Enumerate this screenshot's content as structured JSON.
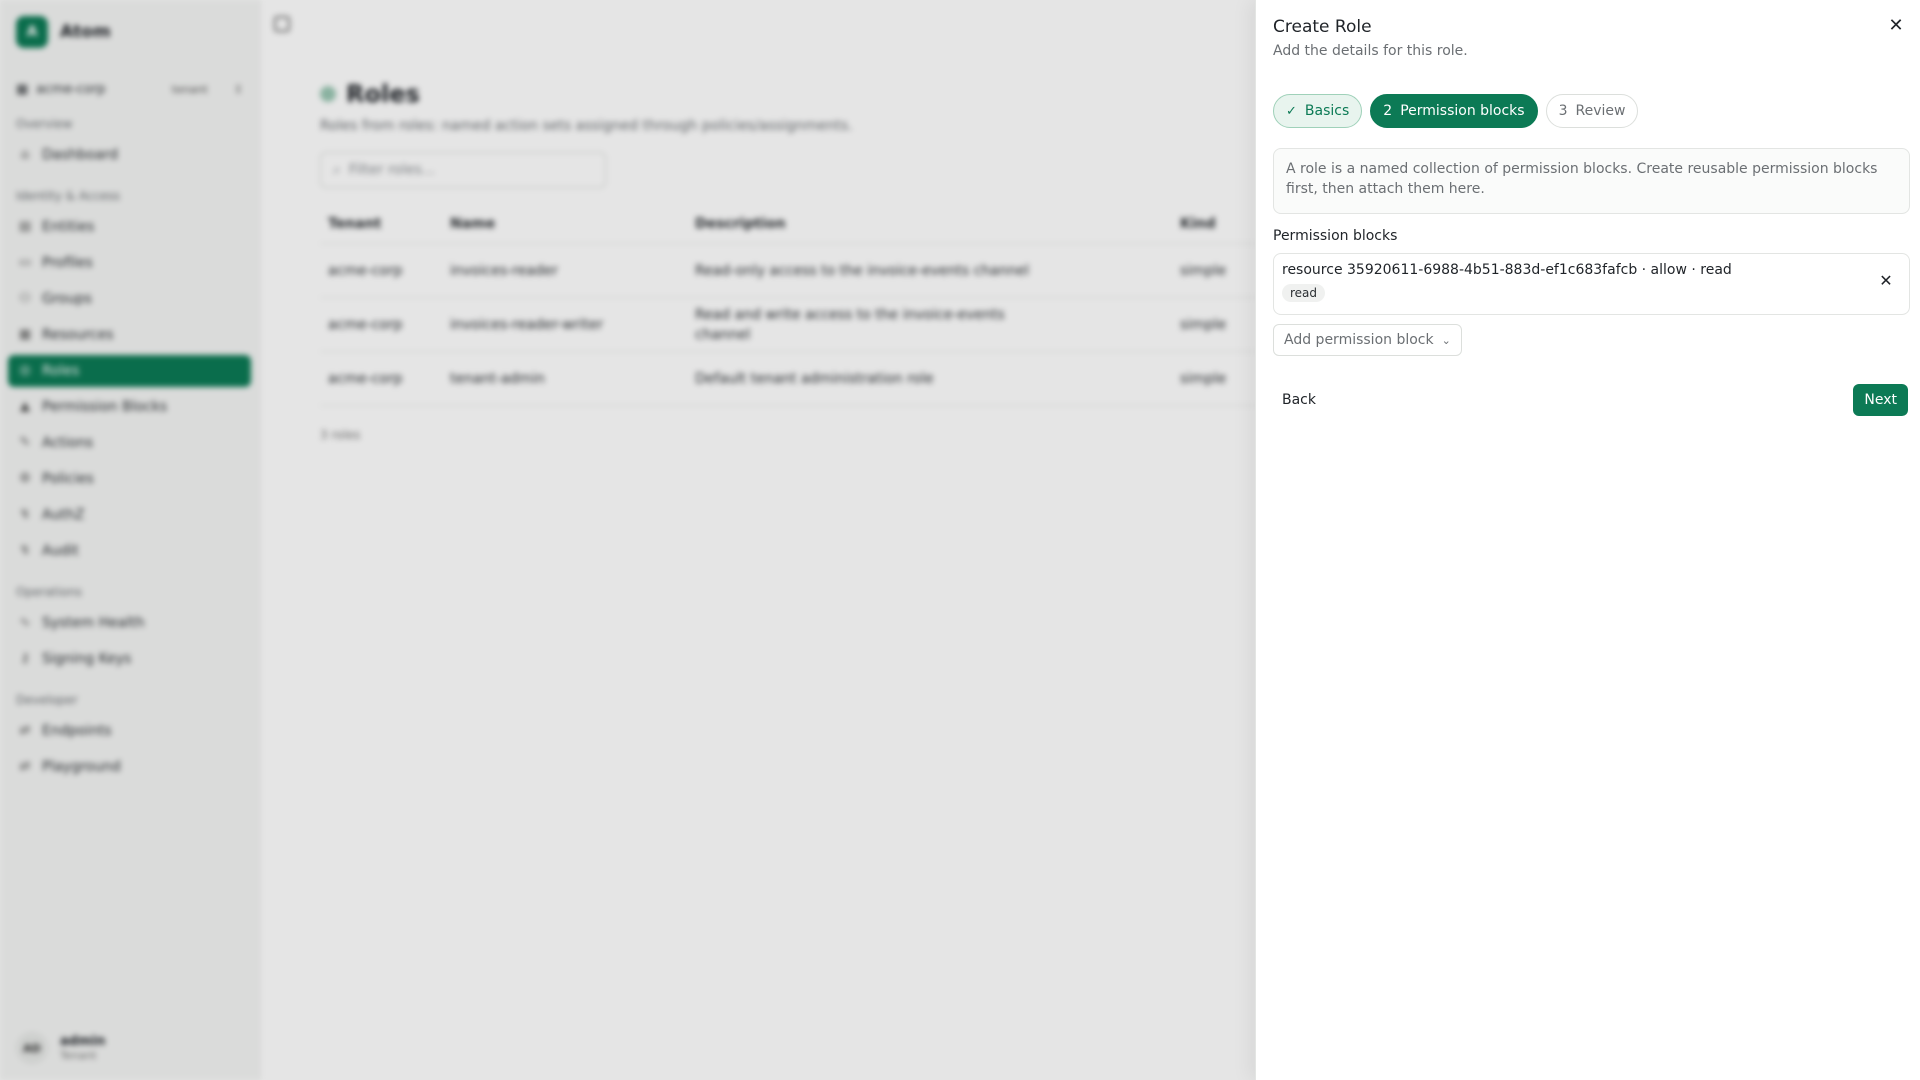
{
  "brand": {
    "name": "Atom",
    "logo_letter": "A"
  },
  "tenant": {
    "name": "acme-corp",
    "badge": "tenant"
  },
  "nav": {
    "sections": [
      {
        "label": "Overview",
        "items": [
          {
            "label": "Dashboard",
            "icon": "home-icon"
          }
        ]
      },
      {
        "label": "Identity & Access",
        "items": [
          {
            "label": "Entities",
            "icon": "entities-icon"
          },
          {
            "label": "Profiles",
            "icon": "profiles-icon"
          },
          {
            "label": "Groups",
            "icon": "groups-icon"
          },
          {
            "label": "Resources",
            "icon": "resources-icon"
          },
          {
            "label": "Roles",
            "icon": "roles-icon",
            "active": true
          },
          {
            "label": "Permission Blocks",
            "icon": "lock-icon"
          },
          {
            "label": "Actions",
            "icon": "actions-icon"
          },
          {
            "label": "Policies",
            "icon": "policies-icon"
          },
          {
            "label": "AuthZ",
            "icon": "authz-icon"
          },
          {
            "label": "Audit",
            "icon": "audit-icon"
          }
        ]
      },
      {
        "label": "Operations",
        "items": [
          {
            "label": "System Health",
            "icon": "health-icon"
          },
          {
            "label": "Signing Keys",
            "icon": "key-icon"
          }
        ]
      },
      {
        "label": "Developer",
        "items": [
          {
            "label": "Endpoints",
            "icon": "endpoints-icon"
          },
          {
            "label": "Playground",
            "icon": "playground-icon"
          }
        ]
      }
    ]
  },
  "user": {
    "initials": "AD",
    "name": "admin",
    "role": "Tenant"
  },
  "page": {
    "title": "Roles",
    "subtitle": "Roles from roles: named action sets assigned through policies/assignments.",
    "filter_placeholder": "Filter roles...",
    "columns": [
      "Tenant",
      "Name",
      "Description",
      "Kind"
    ],
    "rows": [
      [
        "acme-corp",
        "invoices-reader",
        "Read-only access to the invoice-events channel",
        "simple"
      ],
      [
        "acme-corp",
        "invoices-reader-writer",
        "Read and write access to the invoice-events channel",
        "simple"
      ],
      [
        "acme-corp",
        "tenant-admin",
        "Default tenant administration role",
        "simple"
      ]
    ],
    "count": "3 roles"
  },
  "sheet": {
    "title": "Create Role",
    "subtitle": "Add the details for this role.",
    "steps": [
      {
        "label": "Basics",
        "prefix": "✓",
        "state": "done"
      },
      {
        "label": "Permission blocks",
        "prefix": "2",
        "state": "current"
      },
      {
        "label": "Review",
        "prefix": "3",
        "state": "todo"
      }
    ],
    "info": "A role is a named collection of permission blocks. Create reusable permission blocks first, then attach them here.",
    "section_label": "Permission blocks",
    "block": {
      "text": "resource 35920611-6988-4b51-883d-ef1c683fafcb · allow · read",
      "chip": "read"
    },
    "add_label": "Add permission block",
    "back_label": "Back",
    "next_label": "Next"
  },
  "colors": {
    "accent": "#0c7a55",
    "accent_soft": "#e8f4ee"
  }
}
